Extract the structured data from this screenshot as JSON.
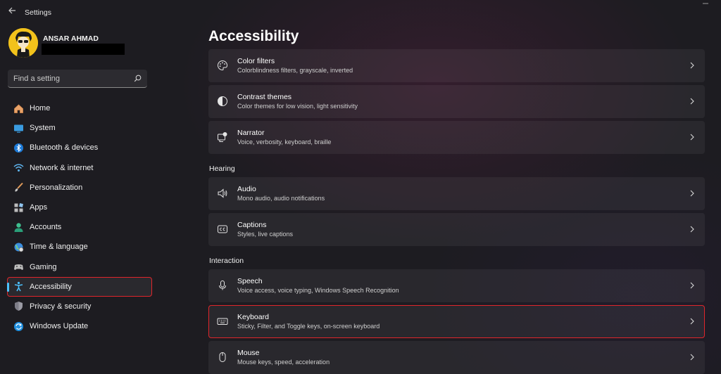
{
  "window": {
    "title": "Settings"
  },
  "profile": {
    "name": "ANSAR AHMAD"
  },
  "search": {
    "placeholder": "Find a setting"
  },
  "sidebar": {
    "items": [
      {
        "label": "Home",
        "icon": "home-icon"
      },
      {
        "label": "System",
        "icon": "system-icon"
      },
      {
        "label": "Bluetooth & devices",
        "icon": "bluetooth-icon"
      },
      {
        "label": "Network & internet",
        "icon": "wifi-icon"
      },
      {
        "label": "Personalization",
        "icon": "brush-icon"
      },
      {
        "label": "Apps",
        "icon": "apps-icon"
      },
      {
        "label": "Accounts",
        "icon": "accounts-icon"
      },
      {
        "label": "Time & language",
        "icon": "globe-icon"
      },
      {
        "label": "Gaming",
        "icon": "gamepad-icon"
      },
      {
        "label": "Accessibility",
        "icon": "accessibility-icon",
        "selected": true
      },
      {
        "label": "Privacy & security",
        "icon": "shield-icon"
      },
      {
        "label": "Windows Update",
        "icon": "update-icon"
      }
    ]
  },
  "main": {
    "title": "Accessibility",
    "rows_top": [
      {
        "title": "Color filters",
        "subtitle": "Colorblindness filters, grayscale, inverted",
        "icon": "palette-icon"
      },
      {
        "title": "Contrast themes",
        "subtitle": "Color themes for low vision, light sensitivity",
        "icon": "contrast-icon"
      },
      {
        "title": "Narrator",
        "subtitle": "Voice, verbosity, keyboard, braille",
        "icon": "narrator-icon"
      }
    ],
    "hearing": {
      "heading": "Hearing",
      "rows": [
        {
          "title": "Audio",
          "subtitle": "Mono audio, audio notifications",
          "icon": "speaker-icon"
        },
        {
          "title": "Captions",
          "subtitle": "Styles, live captions",
          "icon": "captions-icon"
        }
      ]
    },
    "interaction": {
      "heading": "Interaction",
      "rows": [
        {
          "title": "Speech",
          "subtitle": "Voice access, voice typing, Windows Speech Recognition",
          "icon": "microphone-icon"
        },
        {
          "title": "Keyboard",
          "subtitle": "Sticky, Filter, and Toggle keys, on-screen keyboard",
          "icon": "keyboard-icon",
          "highlighted": true
        },
        {
          "title": "Mouse",
          "subtitle": "Mouse keys, speed, acceleration",
          "icon": "mouse-icon"
        }
      ]
    }
  },
  "colors": {
    "accent": "#4cc2ff",
    "highlight_outline": "#e0252b",
    "card_bg": "#2a292e",
    "avatar_bg": "#f2c21b"
  }
}
